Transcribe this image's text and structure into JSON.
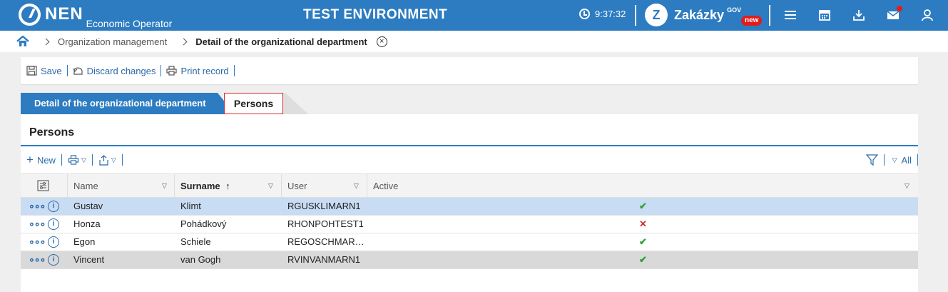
{
  "header": {
    "logo_text": "NEN",
    "logo_sub": "Economic Operator",
    "env_title": "TEST ENVIRONMENT",
    "clock": "9:37:32",
    "zakazky": "Zakázky",
    "zakazky_sup": "GOV",
    "badge": "new"
  },
  "breadcrumb": {
    "item1": "Organization management",
    "current": "Detail of the organizational department",
    "close_symbol": "×"
  },
  "toolbar": {
    "save": "Save",
    "discard": "Discard changes",
    "print": "Print record"
  },
  "tabs": {
    "detail": "Detail of the organizational department",
    "persons": "Persons"
  },
  "panel": {
    "title": "Persons",
    "new_label": "New",
    "all_label": "All"
  },
  "grid": {
    "columns": [
      "Name",
      "Surname",
      "User",
      "Active"
    ],
    "sort_arrow": "↑",
    "rows": [
      {
        "name": "Gustav",
        "surname": "Klimt",
        "user": "RGUSKLIMARN1",
        "active": "✔"
      },
      {
        "name": "Honza",
        "surname": "Pohádkový",
        "user": "RHONPOHTEST1",
        "active": "✕"
      },
      {
        "name": "Egon",
        "surname": "Schiele",
        "user": "REGOSCHMAR…",
        "active": "✔"
      },
      {
        "name": "Vincent",
        "surname": "van Gogh",
        "user": "RVINVANMARN1",
        "active": "✔"
      }
    ]
  },
  "colors": {
    "brand_blue": "#2d7cc1",
    "selected_row": "#c8dcf3",
    "alert_red": "#e21b1b",
    "check_green": "#2e9e3a"
  }
}
